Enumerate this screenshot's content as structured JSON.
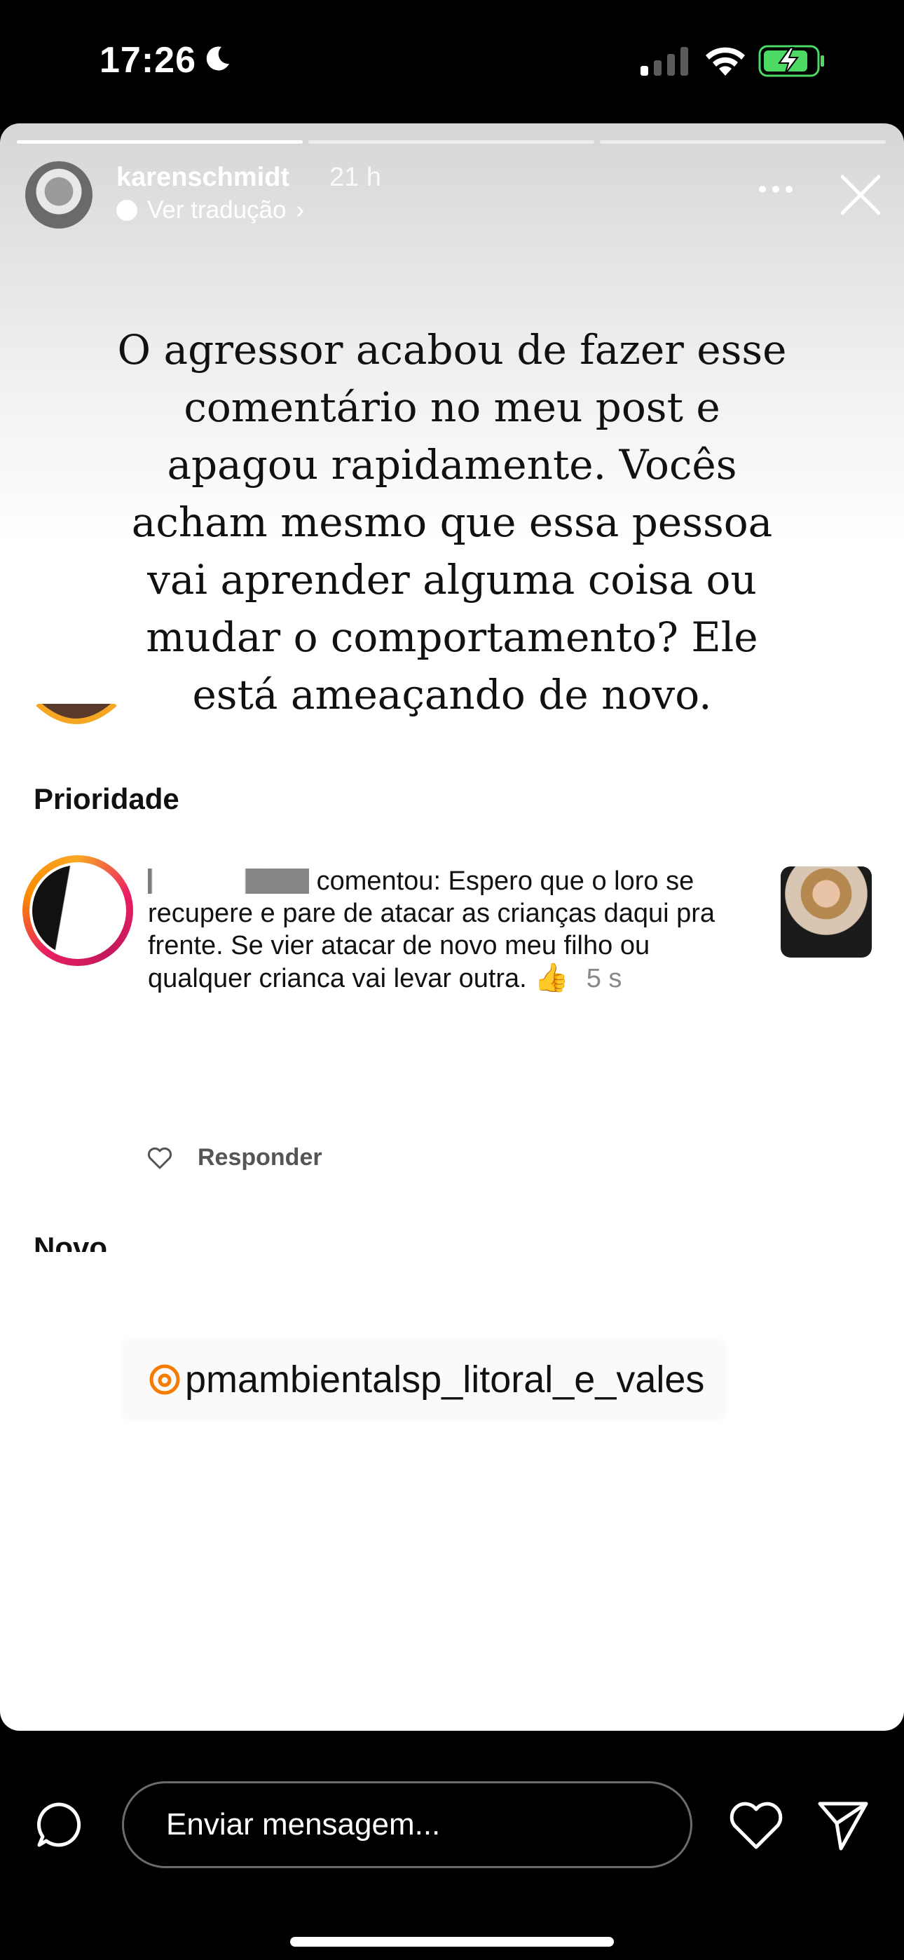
{
  "status_bar": {
    "time": "17:26",
    "icons": [
      "moon-icon",
      "signal-icon",
      "wifi-icon",
      "battery-charging-icon"
    ],
    "battery_color": "#4cd964"
  },
  "story": {
    "segments": [
      {
        "progress": 1.0
      },
      {
        "progress": 0.0
      },
      {
        "progress": 0.0
      }
    ],
    "username": "karenschmidt",
    "time_ago": "21 h",
    "translate_label": "Ver tradução",
    "translate_chevron": "›",
    "caption": "O agressor acabou de fazer esse comentário no meu post e apagou rapidamente. Vocês acham mesmo que essa pessoa vai aprender alguma coisa ou mudar o comportamento? Ele está ameaçando de novo.",
    "section_priority": "Prioridade",
    "comment": {
      "text": "comentou: Espero que o loro se recupere e pare de atacar as crianças daqui pra frente.  Se vier atacar de novo meu filho ou qualquer crianca vai levar outra.",
      "emoji": "👍",
      "time": "5 s",
      "reply_label": "Responder"
    },
    "section_new": "Novo",
    "mention": "pmambientalsp_litoral_e_vales"
  },
  "bottom_bar": {
    "message_placeholder": "Enviar mensagem..."
  }
}
